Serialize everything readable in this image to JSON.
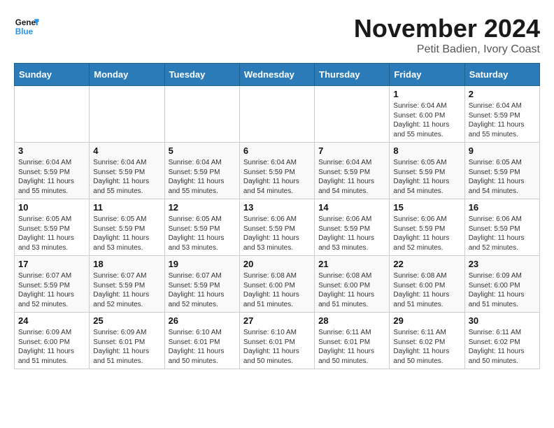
{
  "header": {
    "logo_line1": "General",
    "logo_line2": "Blue",
    "month": "November 2024",
    "location": "Petit Badien, Ivory Coast"
  },
  "weekdays": [
    "Sunday",
    "Monday",
    "Tuesday",
    "Wednesday",
    "Thursday",
    "Friday",
    "Saturday"
  ],
  "weeks": [
    {
      "row_shade": false,
      "days": [
        {
          "date": "",
          "info": ""
        },
        {
          "date": "",
          "info": ""
        },
        {
          "date": "",
          "info": ""
        },
        {
          "date": "",
          "info": ""
        },
        {
          "date": "",
          "info": ""
        },
        {
          "date": "1",
          "info": "Sunrise: 6:04 AM\nSunset: 6:00 PM\nDaylight: 11 hours\nand 55 minutes."
        },
        {
          "date": "2",
          "info": "Sunrise: 6:04 AM\nSunset: 5:59 PM\nDaylight: 11 hours\nand 55 minutes."
        }
      ]
    },
    {
      "row_shade": true,
      "days": [
        {
          "date": "3",
          "info": "Sunrise: 6:04 AM\nSunset: 5:59 PM\nDaylight: 11 hours\nand 55 minutes."
        },
        {
          "date": "4",
          "info": "Sunrise: 6:04 AM\nSunset: 5:59 PM\nDaylight: 11 hours\nand 55 minutes."
        },
        {
          "date": "5",
          "info": "Sunrise: 6:04 AM\nSunset: 5:59 PM\nDaylight: 11 hours\nand 55 minutes."
        },
        {
          "date": "6",
          "info": "Sunrise: 6:04 AM\nSunset: 5:59 PM\nDaylight: 11 hours\nand 54 minutes."
        },
        {
          "date": "7",
          "info": "Sunrise: 6:04 AM\nSunset: 5:59 PM\nDaylight: 11 hours\nand 54 minutes."
        },
        {
          "date": "8",
          "info": "Sunrise: 6:05 AM\nSunset: 5:59 PM\nDaylight: 11 hours\nand 54 minutes."
        },
        {
          "date": "9",
          "info": "Sunrise: 6:05 AM\nSunset: 5:59 PM\nDaylight: 11 hours\nand 54 minutes."
        }
      ]
    },
    {
      "row_shade": false,
      "days": [
        {
          "date": "10",
          "info": "Sunrise: 6:05 AM\nSunset: 5:59 PM\nDaylight: 11 hours\nand 53 minutes."
        },
        {
          "date": "11",
          "info": "Sunrise: 6:05 AM\nSunset: 5:59 PM\nDaylight: 11 hours\nand 53 minutes."
        },
        {
          "date": "12",
          "info": "Sunrise: 6:05 AM\nSunset: 5:59 PM\nDaylight: 11 hours\nand 53 minutes."
        },
        {
          "date": "13",
          "info": "Sunrise: 6:06 AM\nSunset: 5:59 PM\nDaylight: 11 hours\nand 53 minutes."
        },
        {
          "date": "14",
          "info": "Sunrise: 6:06 AM\nSunset: 5:59 PM\nDaylight: 11 hours\nand 53 minutes."
        },
        {
          "date": "15",
          "info": "Sunrise: 6:06 AM\nSunset: 5:59 PM\nDaylight: 11 hours\nand 52 minutes."
        },
        {
          "date": "16",
          "info": "Sunrise: 6:06 AM\nSunset: 5:59 PM\nDaylight: 11 hours\nand 52 minutes."
        }
      ]
    },
    {
      "row_shade": true,
      "days": [
        {
          "date": "17",
          "info": "Sunrise: 6:07 AM\nSunset: 5:59 PM\nDaylight: 11 hours\nand 52 minutes."
        },
        {
          "date": "18",
          "info": "Sunrise: 6:07 AM\nSunset: 5:59 PM\nDaylight: 11 hours\nand 52 minutes."
        },
        {
          "date": "19",
          "info": "Sunrise: 6:07 AM\nSunset: 5:59 PM\nDaylight: 11 hours\nand 52 minutes."
        },
        {
          "date": "20",
          "info": "Sunrise: 6:08 AM\nSunset: 6:00 PM\nDaylight: 11 hours\nand 51 minutes."
        },
        {
          "date": "21",
          "info": "Sunrise: 6:08 AM\nSunset: 6:00 PM\nDaylight: 11 hours\nand 51 minutes."
        },
        {
          "date": "22",
          "info": "Sunrise: 6:08 AM\nSunset: 6:00 PM\nDaylight: 11 hours\nand 51 minutes."
        },
        {
          "date": "23",
          "info": "Sunrise: 6:09 AM\nSunset: 6:00 PM\nDaylight: 11 hours\nand 51 minutes."
        }
      ]
    },
    {
      "row_shade": false,
      "days": [
        {
          "date": "24",
          "info": "Sunrise: 6:09 AM\nSunset: 6:00 PM\nDaylight: 11 hours\nand 51 minutes."
        },
        {
          "date": "25",
          "info": "Sunrise: 6:09 AM\nSunset: 6:01 PM\nDaylight: 11 hours\nand 51 minutes."
        },
        {
          "date": "26",
          "info": "Sunrise: 6:10 AM\nSunset: 6:01 PM\nDaylight: 11 hours\nand 50 minutes."
        },
        {
          "date": "27",
          "info": "Sunrise: 6:10 AM\nSunset: 6:01 PM\nDaylight: 11 hours\nand 50 minutes."
        },
        {
          "date": "28",
          "info": "Sunrise: 6:11 AM\nSunset: 6:01 PM\nDaylight: 11 hours\nand 50 minutes."
        },
        {
          "date": "29",
          "info": "Sunrise: 6:11 AM\nSunset: 6:02 PM\nDaylight: 11 hours\nand 50 minutes."
        },
        {
          "date": "30",
          "info": "Sunrise: 6:11 AM\nSunset: 6:02 PM\nDaylight: 11 hours\nand 50 minutes."
        }
      ]
    }
  ]
}
